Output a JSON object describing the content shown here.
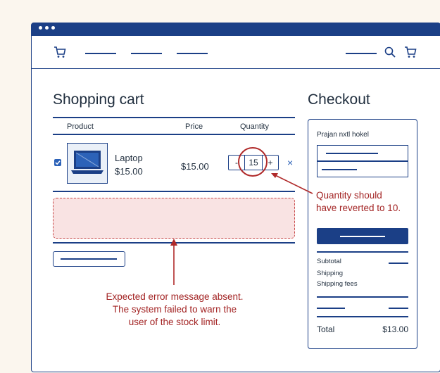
{
  "cart": {
    "title": "Shopping cart",
    "columns": [
      "Product",
      "Price",
      "Quantity"
    ],
    "item": {
      "name": "Laptop",
      "unit_price": "$15.00",
      "price": "$15.00",
      "quantity": "15",
      "minus": "-",
      "plus": "+",
      "remove": "×"
    }
  },
  "checkout": {
    "title": "Checkout",
    "label": "Prajan nxtl hokel",
    "summary_labels": [
      "Subtotal",
      "Shipping",
      "Shipping fees"
    ],
    "total_label": "Total",
    "total_value": "$13.00"
  },
  "annotations": {
    "quantity_note": [
      "Quantity should",
      "have reverted to 10."
    ],
    "error_note": [
      "Expected error message absent.",
      "The system failed to warn the",
      "user of the stock limit."
    ]
  },
  "colors": {
    "brand": "#1b3f86",
    "accent": "#2c62b8",
    "annotation": "#b02a2a",
    "error_fill": "#f9e3e3"
  },
  "icons": {
    "nav_left": "cart-icon",
    "nav_search": "search-icon",
    "nav_right": "cart-icon",
    "item_image": "laptop-icon",
    "checkbox": "checkbox-checked-icon",
    "remove": "close-icon"
  }
}
